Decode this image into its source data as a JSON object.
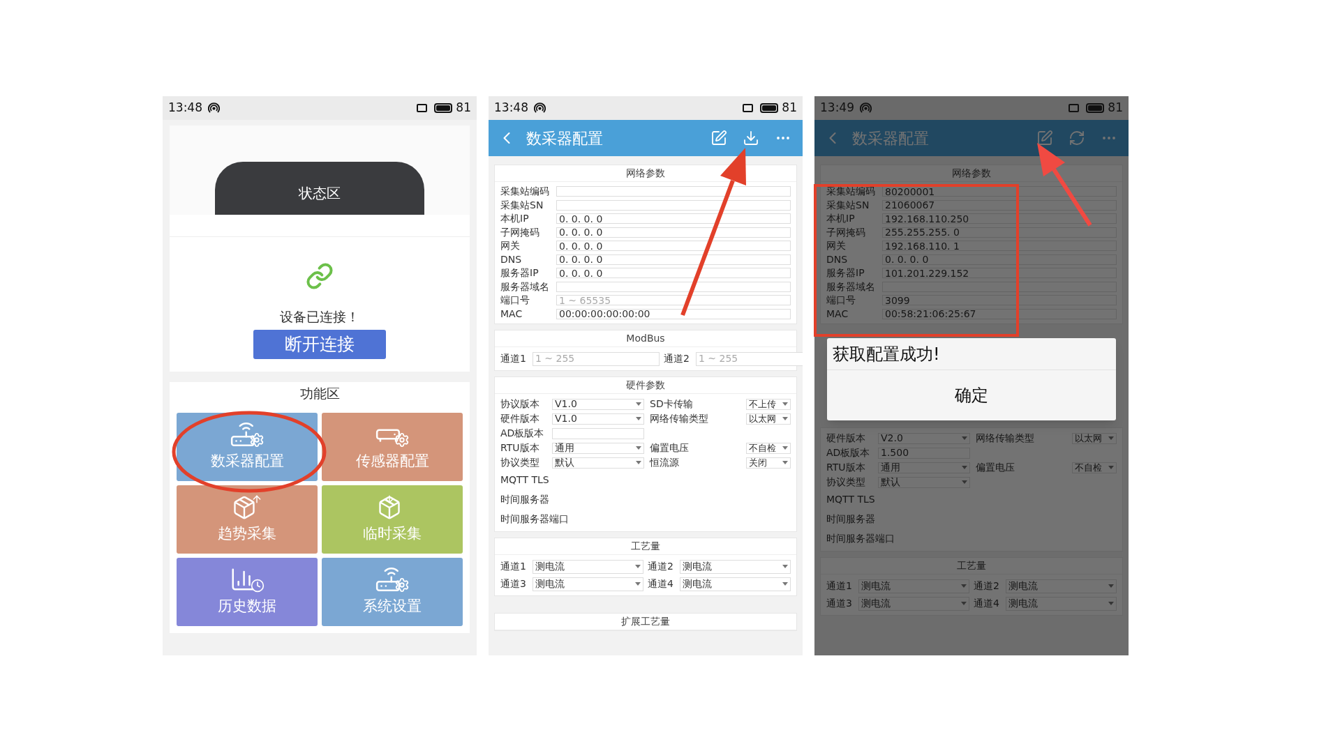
{
  "screens": [
    {
      "kind": "home",
      "status_bar": {
        "time": "13:48",
        "battery": "81"
      },
      "status_area": {
        "title": "状态区"
      },
      "connection": {
        "message": "设备已连接！",
        "button": "断开连接"
      },
      "function_area": {
        "title": "功能区",
        "tiles": [
          {
            "label": "数采器配置",
            "kind": "router",
            "color": "#7ba7d3"
          },
          {
            "label": "传感器配置",
            "kind": "sensor",
            "color": "#d4957a"
          },
          {
            "label": "趋势采集",
            "kind": "box-out",
            "color": "#d4957a"
          },
          {
            "label": "临时采集",
            "kind": "box-in",
            "color": "#acc561"
          },
          {
            "label": "历史数据",
            "kind": "chart",
            "color": "#8587d9"
          },
          {
            "label": "系统设置",
            "kind": "router",
            "color": "#7ba7d3"
          }
        ]
      }
    },
    {
      "kind": "config",
      "dimmed": false,
      "status_bar": {
        "time": "13:48",
        "battery": "81"
      },
      "header": {
        "title": "数采器配置",
        "actions": [
          {
            "kind": "edit"
          },
          {
            "kind": "download"
          },
          {
            "kind": "more"
          }
        ]
      },
      "sections": [
        {
          "kind": "network",
          "title": "网络参数",
          "rows": [
            {
              "label": "采集站编码"
            },
            {
              "label": "采集站SN"
            },
            {
              "label": "本机IP",
              "value": "0. 0. 0. 0"
            },
            {
              "label": "子网掩码",
              "value": "0. 0. 0. 0"
            },
            {
              "label": "网关",
              "value": "0. 0. 0. 0"
            },
            {
              "label": "DNS",
              "value": "0. 0. 0. 0"
            },
            {
              "label": "服务器IP",
              "value": "0. 0. 0. 0"
            },
            {
              "label": "服务器域名"
            },
            {
              "label": "端口号",
              "placeholder": "1 ~ 65535"
            },
            {
              "label": "MAC",
              "value": "00:00:00:00:00:00"
            }
          ]
        },
        {
          "kind": "modbus",
          "title": "ModBus",
          "cells": [
            {
              "label": "通道1",
              "placeholder": "1 ~ 255"
            },
            {
              "label": "通道2",
              "placeholder": "1 ~ 255"
            }
          ]
        },
        {
          "kind": "hardware",
          "title": "硬件参数",
          "rows": [
            {
              "kind": "pair",
              "left": {
                "label": "协议版本",
                "value": "V1.0",
                "kind": "select"
              },
              "right": {
                "label": "SD卡传输",
                "value": "不上传"
              }
            },
            {
              "kind": "pair",
              "left": {
                "label": "硬件版本",
                "value": "V1.0",
                "kind": "select"
              },
              "right": {
                "label": "网络传输类型",
                "value": "以太网"
              }
            },
            {
              "kind": "pair",
              "left": {
                "label": "AD板版本",
                "kind": "input"
              }
            },
            {
              "kind": "pair",
              "left": {
                "label": "RTU版本",
                "value": "通用",
                "kind": "select"
              },
              "right": {
                "label": "偏置电压",
                "value": "不自检"
              }
            },
            {
              "kind": "pair",
              "left": {
                "label": "协议类型",
                "value": "默认",
                "kind": "select"
              },
              "right": {
                "label": "恒流源",
                "value": "关闭"
              }
            },
            {
              "kind": "plain",
              "label": "MQTT TLS"
            },
            {
              "kind": "plain",
              "label": "时间服务器"
            },
            {
              "kind": "plain",
              "label": "时间服务器端口"
            }
          ]
        },
        {
          "kind": "process",
          "title": "工艺量",
          "cells": [
            {
              "label": "通道1",
              "value": "测电流"
            },
            {
              "label": "通道2",
              "value": "测电流"
            },
            {
              "label": "通道3",
              "value": "测电流"
            },
            {
              "label": "通道4",
              "value": "测电流"
            }
          ]
        },
        {
          "kind": "extension",
          "title": "扩展工艺量"
        }
      ]
    },
    {
      "kind": "config",
      "dimmed": true,
      "status_bar": {
        "time": "13:49",
        "battery": "81"
      },
      "header": {
        "title": "数采器配置",
        "actions": [
          {
            "kind": "edit"
          },
          {
            "kind": "refresh"
          },
          {
            "kind": "more"
          }
        ]
      },
      "sections": [
        {
          "kind": "network",
          "title": "网络参数",
          "rows": [
            {
              "label": "采集站编码",
              "value": "80200001"
            },
            {
              "label": "采集站SN",
              "value": "21060067"
            },
            {
              "label": "本机IP",
              "value": "192.168.110.250"
            },
            {
              "label": "子网掩码",
              "value": "255.255.255. 0"
            },
            {
              "label": "网关",
              "value": "192.168.110. 1"
            },
            {
              "label": "DNS",
              "value": "0. 0. 0. 0"
            },
            {
              "label": "服务器IP",
              "value": "101.201.229.152"
            },
            {
              "label": "服务器域名"
            },
            {
              "label": "端口号",
              "value": "3099"
            },
            {
              "label": "MAC",
              "value": "00:58:21:06:25:67"
            }
          ]
        },
        {
          "kind": "hardware",
          "rows": [
            {
              "kind": "pair",
              "left": {
                "label": "硬件版本",
                "value": "V2.0",
                "kind": "select"
              },
              "right": {
                "label": "网络传输类型",
                "value": "以太网"
              }
            },
            {
              "kind": "pair",
              "left": {
                "label": "AD板版本",
                "value": "1.500",
                "kind": "input"
              }
            },
            {
              "kind": "pair",
              "left": {
                "label": "RTU版本",
                "value": "通用",
                "kind": "select"
              },
              "right": {
                "label": "偏置电压",
                "value": "不自检"
              }
            },
            {
              "kind": "pair",
              "left": {
                "label": "协议类型",
                "value": "默认",
                "kind": "select"
              }
            },
            {
              "kind": "plain",
              "label": "MQTT TLS"
            },
            {
              "kind": "plain",
              "label": "时间服务器"
            },
            {
              "kind": "plain",
              "label": "时间服务器端口"
            }
          ]
        },
        {
          "kind": "process",
          "title": "工艺量",
          "cells": [
            {
              "label": "通道1",
              "value": "测电流"
            },
            {
              "label": "通道2",
              "value": "测电流"
            },
            {
              "label": "通道3",
              "value": "测电流"
            },
            {
              "label": "通道4",
              "value": "测电流"
            }
          ]
        }
      ],
      "dialog": {
        "message": "获取配置成功!",
        "button": "确定"
      }
    }
  ]
}
